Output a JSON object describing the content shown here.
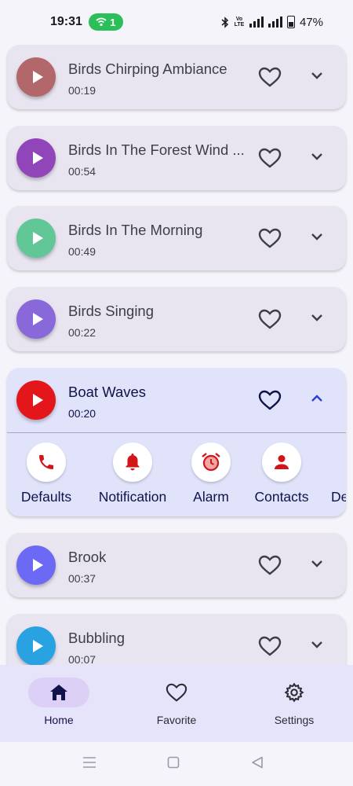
{
  "status_bar": {
    "time": "19:31",
    "hotspot_count": "1",
    "volte": "Vo LTE",
    "battery": "47%"
  },
  "sounds": [
    {
      "title": "Birds Chirping Ambiance",
      "duration": "00:19",
      "color": "#b2676b",
      "expanded": false
    },
    {
      "title": "Birds In The Forest Wind ...",
      "duration": "00:54",
      "color": "#9046b8",
      "expanded": false
    },
    {
      "title": "Birds In The Morning",
      "duration": "00:49",
      "color": "#62c797",
      "expanded": false
    },
    {
      "title": "Birds Singing",
      "duration": "00:22",
      "color": "#8969da",
      "expanded": false
    },
    {
      "title": "Boat Waves",
      "duration": "00:20",
      "color": "#e3161b",
      "expanded": true
    },
    {
      "title": "Brook",
      "duration": "00:37",
      "color": "#6c69f4",
      "expanded": false
    },
    {
      "title": "Bubbling",
      "duration": "00:07",
      "color": "#29a2e2",
      "expanded": false
    }
  ],
  "set_as_actions": [
    {
      "label": "Defaults",
      "icon": "phone-icon"
    },
    {
      "label": "Notification",
      "icon": "bell-icon"
    },
    {
      "label": "Alarm",
      "icon": "alarm-clock-icon"
    },
    {
      "label": "Contacts",
      "icon": "person-icon"
    },
    {
      "label": "De",
      "icon": ""
    }
  ],
  "bottom_nav": {
    "home": "Home",
    "favorite": "Favorite",
    "settings": "Settings",
    "active": "home"
  },
  "colors": {
    "accent": "#12124a",
    "action_icon": "#d3151a",
    "card": "#e8e5f1",
    "card_expanded": "#e1e3fb"
  }
}
